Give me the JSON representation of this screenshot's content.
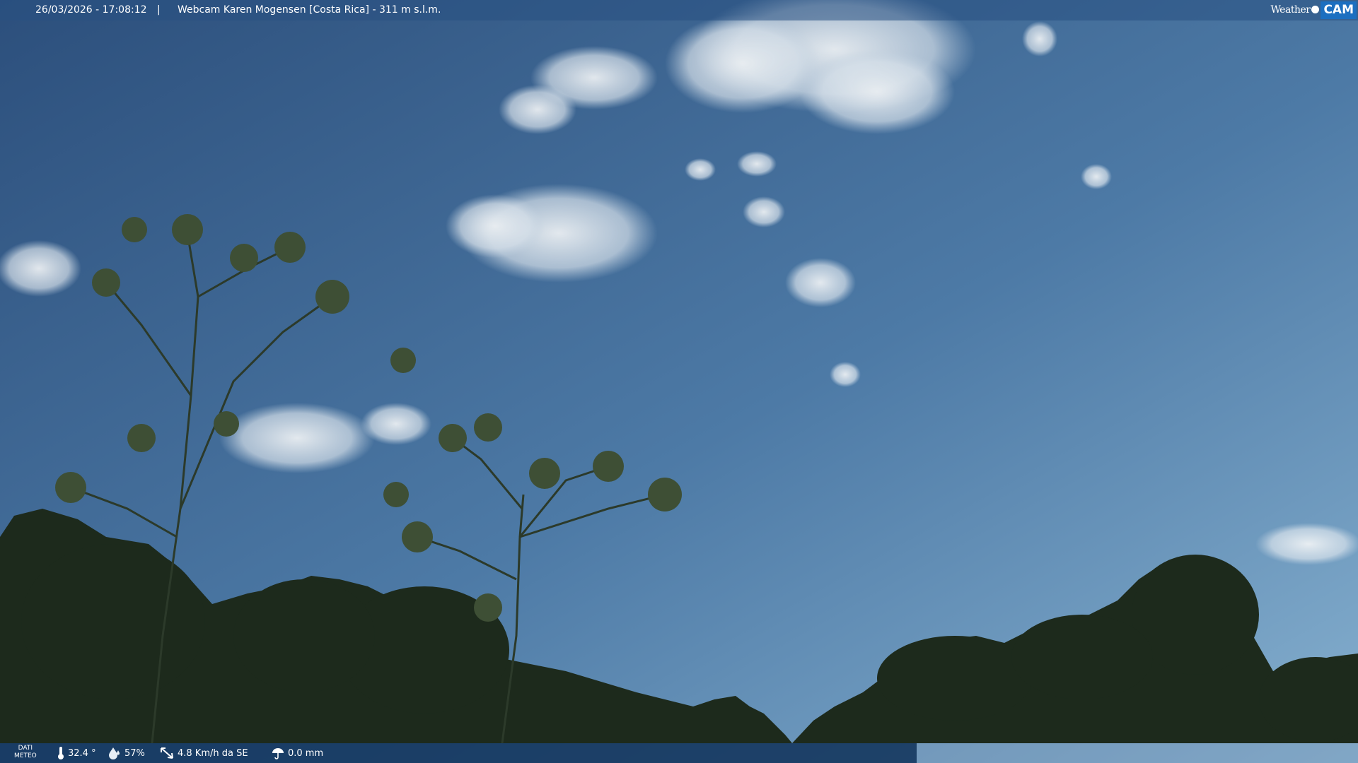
{
  "overlay": {
    "datetime": "26/03/2026 - 17:08:12",
    "separator": "|",
    "title": "Webcam Karen Mogensen [Costa Rica]  - 311 m s.l.m.",
    "logo": {
      "left": "Weather",
      "right": "CAM"
    }
  },
  "weather": {
    "label_line1": "DATI",
    "label_line2": "METEO",
    "temperature": "32.4 °",
    "humidity": "57%",
    "wind": "4.8 Km/h da SE",
    "rain": "0.0 mm"
  },
  "colors": {
    "sky_top": "#2f5380",
    "sky_bottom": "#7ba7c8",
    "foliage": "#1e2b1c",
    "bar": "#12345c",
    "logo_accent": "#1c6fc0"
  }
}
